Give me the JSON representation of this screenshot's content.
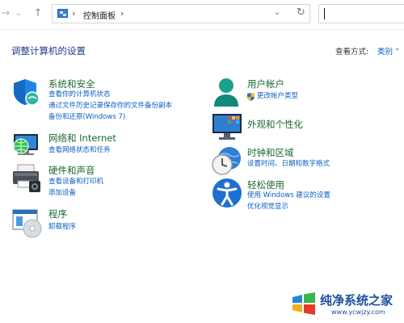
{
  "addressbar": {
    "back_icon": "back-arrow-icon",
    "forward_icon": "forward-arrow-icon",
    "recent_icon": "chevron-down-icon",
    "up_icon": "up-arrow-icon",
    "breadcrumb": "控制面板",
    "search_placeholder": ""
  },
  "header": {
    "title": "调整计算机的设置",
    "view_by_label": "查看方式:",
    "view_by_value": "类别"
  },
  "categories": [
    {
      "title": "系统和安全",
      "links": [
        "查看你的计算机状态",
        "通过文件历史记录保存你的文件备份副本",
        "备份和还原(Windows 7)"
      ],
      "icon": "shield-security-icon"
    },
    {
      "title": "网络和 Internet",
      "links": [
        "查看网络状态和任务"
      ],
      "icon": "network-globe-icon"
    },
    {
      "title": "硬件和声音",
      "links": [
        "查看设备和打印机",
        "添加设备"
      ],
      "icon": "printer-icon"
    },
    {
      "title": "程序",
      "links": [
        "卸载程序"
      ],
      "icon": "programs-disc-icon"
    },
    {
      "title": "用户帐户",
      "links": [
        "更改帐户类型"
      ],
      "icon": "user-account-icon"
    },
    {
      "title": "外观和个性化",
      "links": [],
      "icon": "monitor-personalize-icon"
    },
    {
      "title": "时钟和区域",
      "links": [
        "设置时间、日期和数字格式"
      ],
      "icon": "clock-globe-icon"
    },
    {
      "title": "轻松使用",
      "links": [
        "使用 Windows 建议的设置",
        "优化视觉显示"
      ],
      "icon": "accessibility-icon"
    }
  ],
  "watermark": {
    "title": "纯净系统之家",
    "url": "www.ycwjzy.com"
  },
  "colors": {
    "category_title": "#1a6a2e",
    "link": "#0a5fc4",
    "page_title": "#1e3b8a"
  }
}
